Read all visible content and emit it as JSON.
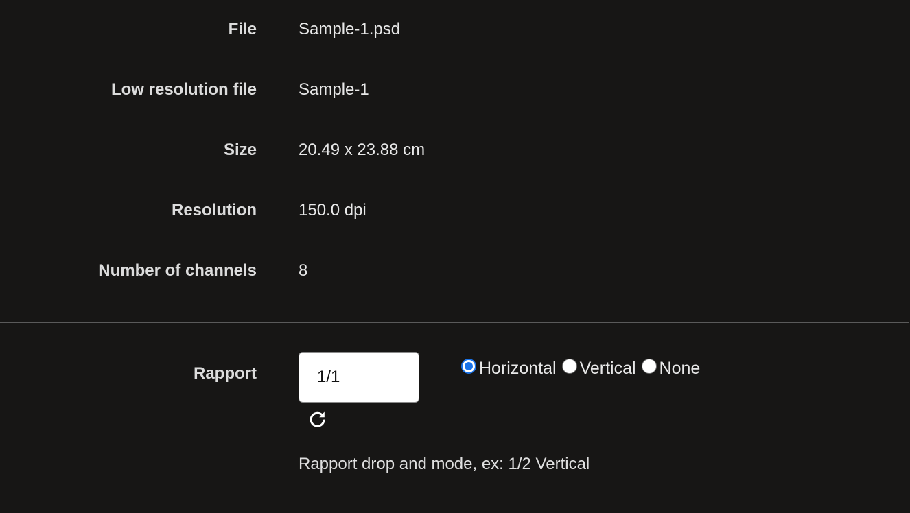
{
  "details": {
    "file": {
      "label": "File",
      "value": "Sample-1.psd"
    },
    "low_res": {
      "label": "Low resolution file",
      "value": "Sample-1"
    },
    "size": {
      "label": "Size",
      "value": "20.49 x 23.88 cm"
    },
    "resolution": {
      "label": "Resolution",
      "value": "150.0 dpi"
    },
    "channels": {
      "label": "Number of channels",
      "value": "8"
    }
  },
  "rapport": {
    "label": "Rapport",
    "input_value": "1/1",
    "options": [
      {
        "label": "Horizontal",
        "checked": true
      },
      {
        "label": "Vertical",
        "checked": false
      },
      {
        "label": "None",
        "checked": false
      }
    ],
    "refresh_icon": "refresh-icon",
    "hint": "Rapport drop and mode, ex: 1/2 Vertical"
  },
  "colors": {
    "background": "#171615",
    "radio_accent": "#1a73e8"
  }
}
